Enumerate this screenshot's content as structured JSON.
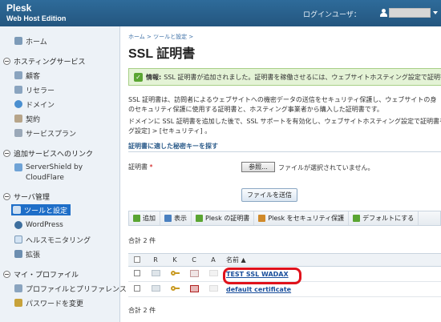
{
  "header": {
    "brand": "Plesk",
    "edition": "Web Host Edition",
    "login_label": "ログインユーザ："
  },
  "sidebar": {
    "home": "ホーム",
    "hosting_services": "ホスティングサービス",
    "customers": "顧客",
    "resellers": "リセラー",
    "domains": "ドメイン",
    "subscriptions": "契約",
    "service_plans": "サービスプラン",
    "addons_link": "追加サービスへのリンク",
    "servershield_1": "ServerShield by",
    "servershield_2": "CloudFlare",
    "server_mgmt": "サーバ管理",
    "tools_settings": "ツールと設定",
    "wordpress": "WordPress",
    "health": "ヘルスモニタリング",
    "extensions": "拡張",
    "my_profile": "マイ・プロファイル",
    "profile_prefs": "プロファイルとプリファレンス",
    "change_password": "パスワードを変更"
  },
  "main": {
    "breadcrumb": "ホーム > ツールと設定 >",
    "title": "SSL 証明書",
    "message_label": "情報:",
    "message": "SSL 証明書が追加されました。証明書を稼働させるには、ウェブサイトホスティング設定で証明書を",
    "desc1": "SSL 証明書は、訪問者によるウェブサイトへの機密データの送信をセキュリティ保護し、ウェブサイトの身",
    "desc2": "のセキュリティ保護に使用する証明書と、ホスティング事業者から購入した証明書です。",
    "desc3": "ドメインに SSL 証明書を追加した後で、SSL サポートを有効化し、ウェブサイトホスティング設定で証明書を",
    "desc4": "グ設定] > [セキュリティ] 。",
    "section_title": "証明書に適した秘密キーを探す",
    "cert_label": "証明書",
    "required_mark": "*",
    "browse_label": "参照...",
    "file_status": "ファイルが選択されていません。",
    "submit_label": "ファイルを送信"
  },
  "toolbar": {
    "add": "追加",
    "view": "表示",
    "plesk_cert": "Plesk の証明書",
    "secure_plesk": "Plesk をセキュリティ保護",
    "make_default": "デフォルトにする"
  },
  "table": {
    "total_top": "合計 2 件",
    "total_bottom": "合計 2 件",
    "headers": {
      "r": "R",
      "k": "K",
      "c": "C",
      "a": "A",
      "name": "名前"
    },
    "rows": [
      {
        "name": "TEST SSL WADAX"
      },
      {
        "name": "default certificate"
      }
    ]
  },
  "colors": {
    "header_bg": "#2e6b9a",
    "active_item": "#1e6ec8",
    "info_bg": "#e4f3d6",
    "highlight": "#e0121c",
    "link": "#1a4f9c"
  }
}
